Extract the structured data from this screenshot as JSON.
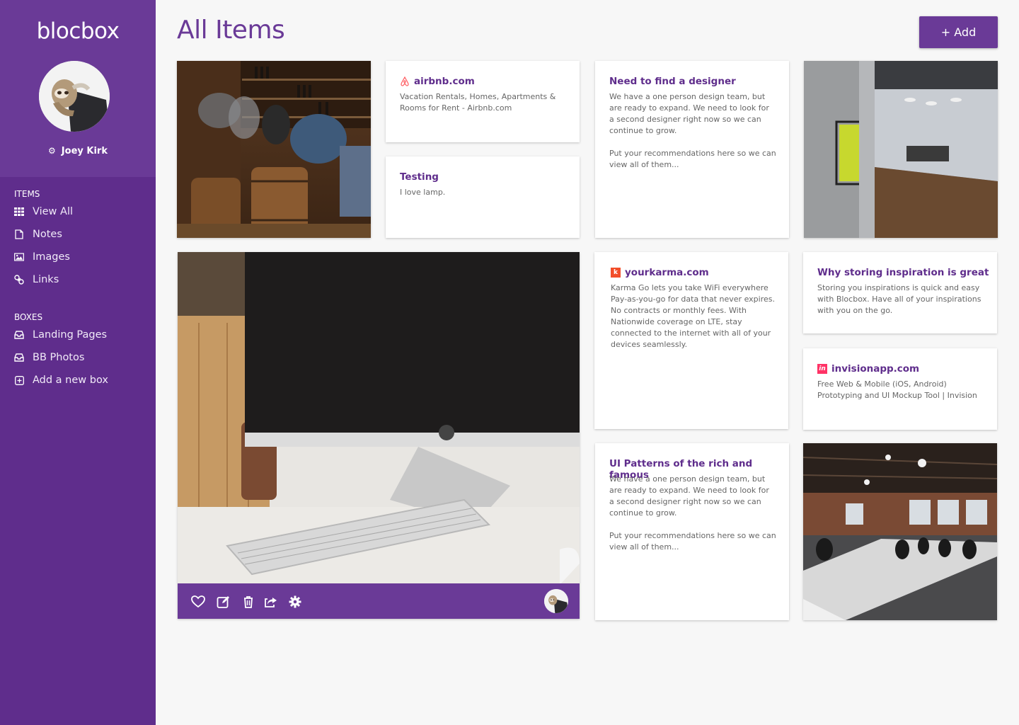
{
  "app": {
    "logo": "blocbox"
  },
  "user": {
    "name": "Joey Kirk"
  },
  "sidebar": {
    "items_label": "ITEMS",
    "items": [
      {
        "label": "View All",
        "icon": "grid-icon"
      },
      {
        "label": "Notes",
        "icon": "note-icon"
      },
      {
        "label": "Images",
        "icon": "image-icon"
      },
      {
        "label": "Links",
        "icon": "link-icon"
      }
    ],
    "boxes_label": "BOXES",
    "boxes": [
      {
        "label": "Landing Pages",
        "icon": "inbox-icon"
      },
      {
        "label": "BB Photos",
        "icon": "inbox-icon"
      },
      {
        "label": "Add a new box",
        "icon": "plus-box-icon"
      }
    ]
  },
  "header": {
    "title": "All Items",
    "add_label": "+ Add"
  },
  "cards": {
    "airbnb": {
      "title": "airbnb.com",
      "body": "Vacation Rentals, Homes, Apartments & Rooms for Rent - Airbnb.com"
    },
    "testing": {
      "title": "Testing",
      "body": "I love lamp."
    },
    "designer": {
      "title": "Need to find a designer",
      "body": "We have a one person design team, but are ready to expand. We need to look for a second designer right now so we can continue to grow.\n\nPut your recommendations here so we can view all of them..."
    },
    "karma": {
      "title": "yourkarma.com",
      "body": "Karma Go lets you take WiFi everywhere Pay-as-you-go for data that never expires. No contracts or monthly fees. With Nationwide coverage on LTE, stay connected to the internet with all of your devices seamlessly."
    },
    "inspiration": {
      "title": "Why storing inspiration is great",
      "body": "Storing you inspirations is quick and easy with Blocbox. Have all of your inspirations with you on the go."
    },
    "invision": {
      "title": "invisionapp.com",
      "body": "Free Web & Mobile (iOS, Android) Prototyping and UI Mockup Tool | Invision"
    },
    "patterns": {
      "title": "UI Patterns of the rich and famous",
      "body": "We have a one person design team, but are ready to expand. We need to look for a second designer right now so we can continue to grow.\n\nPut your recommendations here so we can view all of them..."
    }
  },
  "colors": {
    "brand": "#6a3a97",
    "sidebar": "#5f2d8c",
    "title_text": "#5f2d8c",
    "airbnb": "#ff5a5f",
    "karma": "#f24e2a",
    "invision": "#ff3366"
  }
}
